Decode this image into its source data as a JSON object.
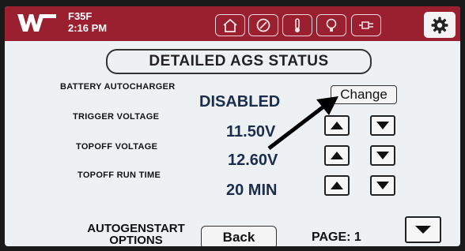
{
  "header": {
    "model": "F35F",
    "time": "2:16 PM",
    "nav_icons": [
      "home-icon",
      "fan-icon",
      "thermometer-icon",
      "light-bulb-icon",
      "plug-icon",
      "gear-icon"
    ],
    "color": "#9a1f2f"
  },
  "main": {
    "title": "DETAILED AGS STATUS",
    "battery_autocharger_label": "BATTERY AUTOCHARGER",
    "battery_autocharger_value": "DISABLED",
    "change_label": "Change",
    "trigger_voltage_label": "TRIGGER VOLTAGE",
    "trigger_voltage_value": "11.50V",
    "topoff_voltage_label": "TOPOFF VOLTAGE",
    "topoff_voltage_value": "12.60V",
    "topoff_run_time_label": "TOPOFF RUN TIME",
    "topoff_run_time_value": "20 MIN"
  },
  "footer": {
    "autogenstart_line1": "AUTOGENSTART",
    "autogenstart_line2": "OPTIONS",
    "back_label": "Back",
    "page_label": "PAGE:  1"
  }
}
